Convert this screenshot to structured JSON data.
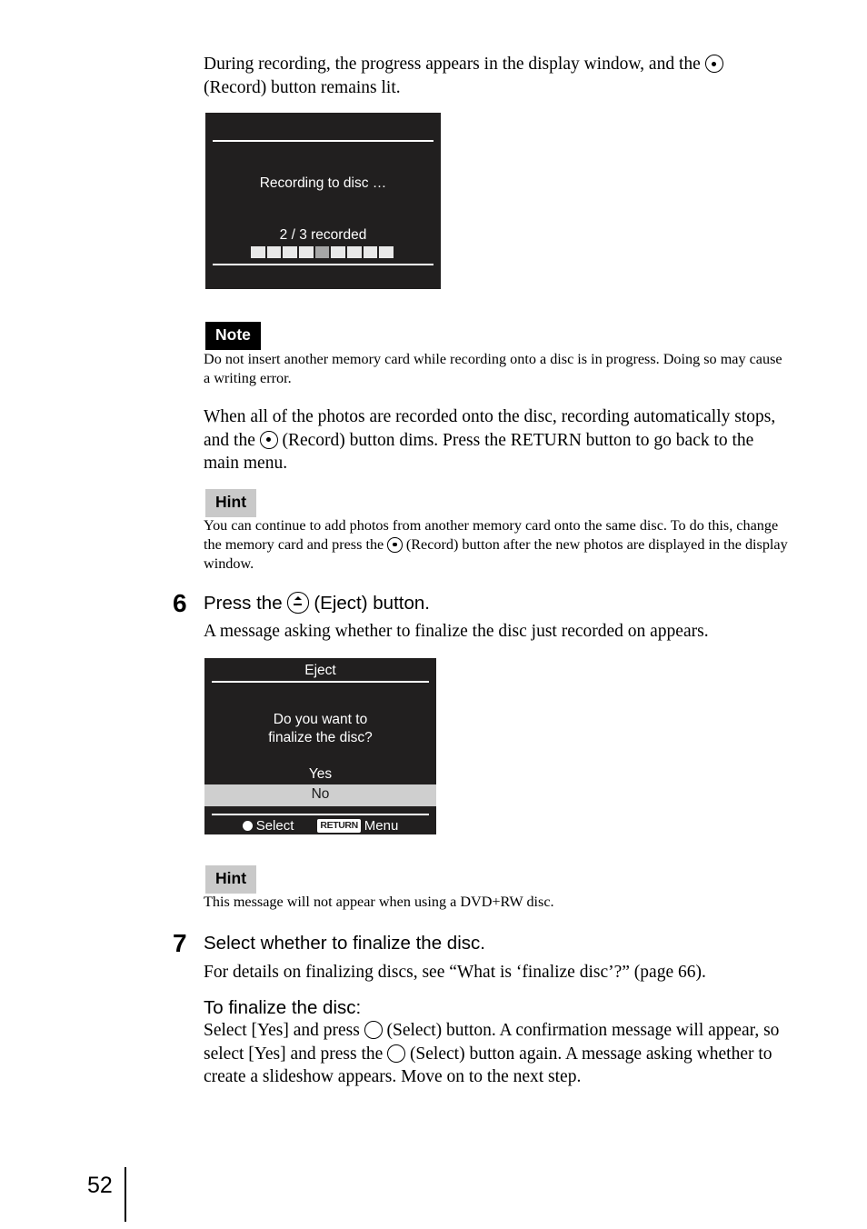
{
  "page": {
    "number": "52"
  },
  "intro": {
    "line1_before": "During recording, the progress appears in the display window, and the ",
    "line1_after": "",
    "line2": "(Record) button remains lit."
  },
  "recording_screen": {
    "title": "",
    "status_text": "Recording to disc …",
    "progress_label": "2 / 3 recorded",
    "progress": {
      "segments": 9,
      "dim_index": 4,
      "recorded": 2,
      "total": 3
    }
  },
  "note_block": {
    "badge": "Note",
    "text": "Do not insert another memory card while recording onto a disc is in progress. Doing so may cause a writing error."
  },
  "auto_stop_paragraph": {
    "part1": "When all of the photos are recorded onto the disc, recording automatically stops, and the ",
    "part2": " (Record) button dims. Press the RETURN button to go back to the main menu."
  },
  "hint_block_1": {
    "badge": "Hint",
    "part1": "You can continue to add photos from another memory card onto the same disc. To do this, change the memory card and press the ",
    "part2": " (Record) button after the new photos are displayed in the display window."
  },
  "step6": {
    "number": "6",
    "heading_part1": "Press the ",
    "heading_part2": " (Eject) button.",
    "body": "A message asking whether to finalize the disc just recorded on appears."
  },
  "eject_screen": {
    "title": "Eject",
    "message_line1": "Do you want to",
    "message_line2": "finalize the disc?",
    "options": [
      {
        "label": "Yes",
        "selected": false
      },
      {
        "label": "No",
        "selected": true
      }
    ],
    "footer": {
      "select_icon": "filled-circle-icon",
      "select_label": "Select",
      "return_badge": "RETURN",
      "menu_label": "Menu"
    }
  },
  "hint_block_2": {
    "badge": "Hint",
    "text": "This message will not appear when using a DVD+RW disc."
  },
  "step7": {
    "number": "7",
    "heading": "Select whether to finalize the disc.",
    "body": "For details on finalizing discs, see “What is ‘finalize disc’?” (page 66).",
    "subheading": "To finalize the disc:",
    "detail_part1": "Select [Yes] and press ",
    "detail_part2": " (Select) button. A confirmation message will appear, so select [Yes] and press the ",
    "detail_part3": " (Select) button again. A message asking whether to create a slideshow appears. Move on to the next step."
  },
  "colors": {
    "device_bg": "#211f1f",
    "device_fg": "#ffffff",
    "selected_row_bg": "#cfcfcf",
    "note_badge_bg": "#000000",
    "hint_badge_bg": "#c9c9c9",
    "progress_seg": "#e9e9e9",
    "progress_seg_dim": "#a6a6a6"
  }
}
